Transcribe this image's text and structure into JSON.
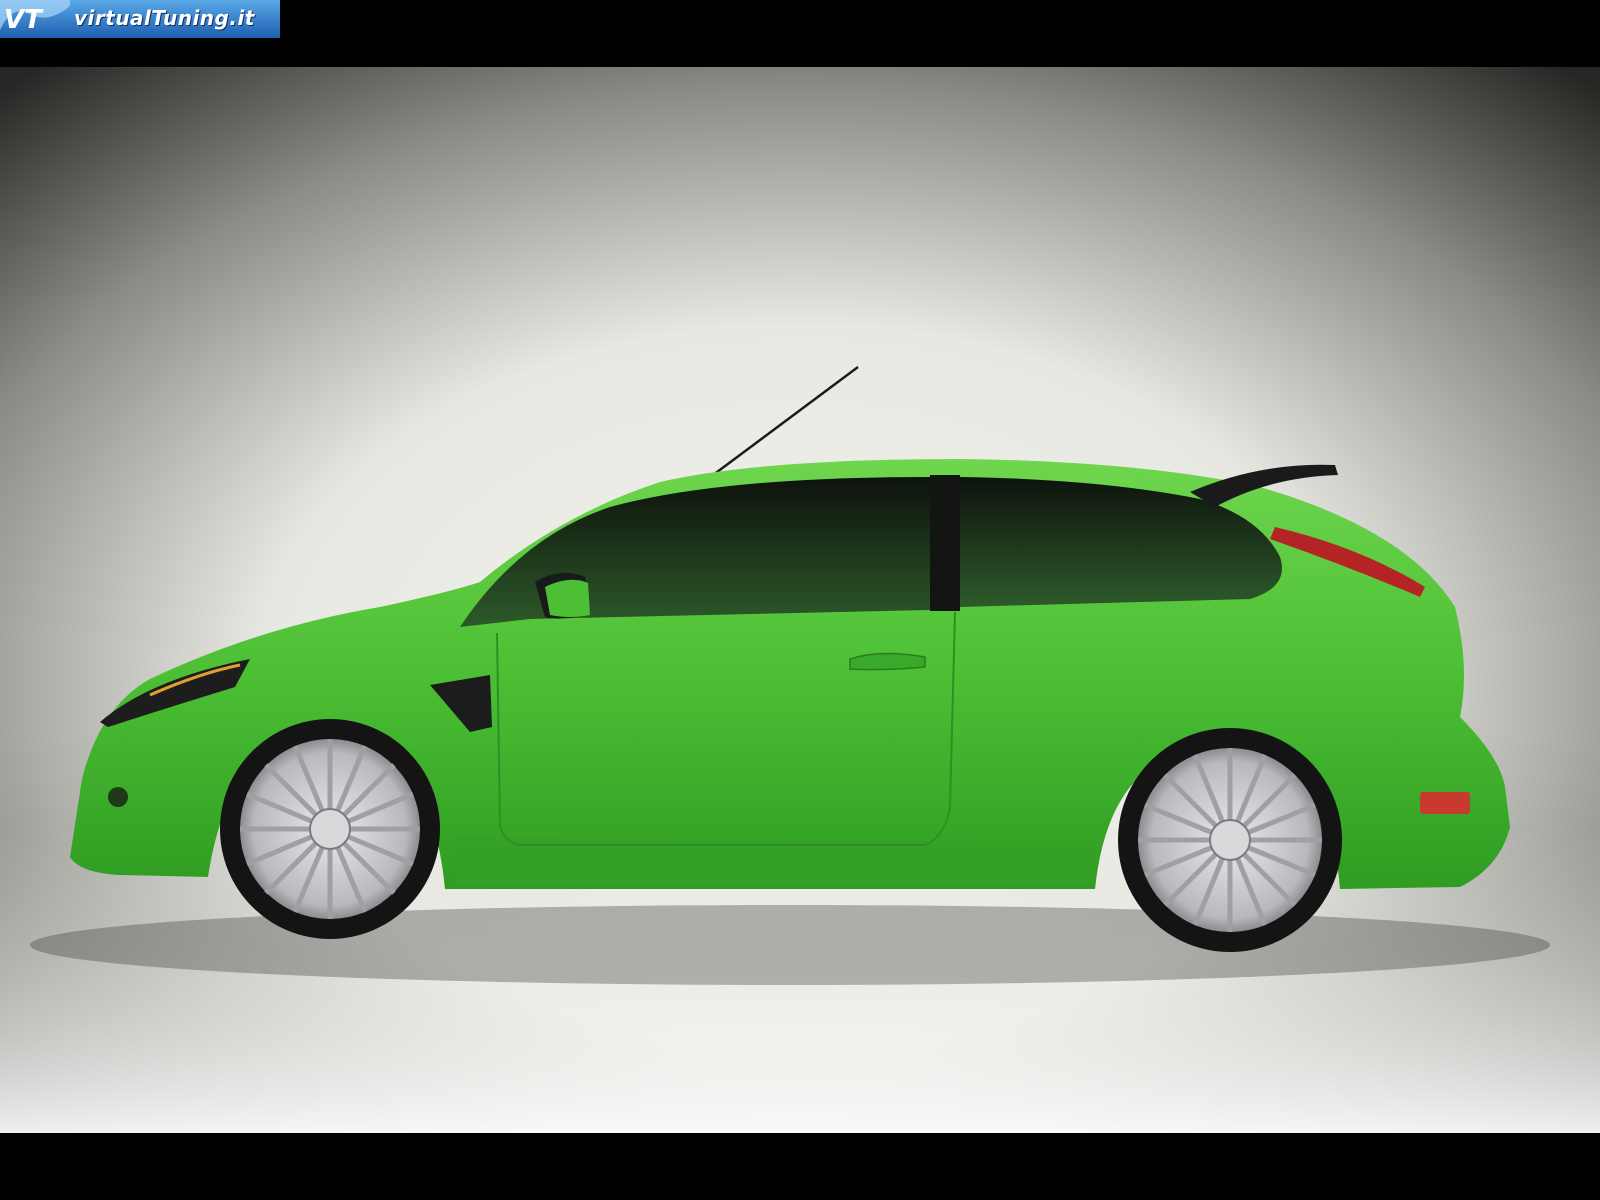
{
  "watermark": {
    "text": "virtualTuning.it",
    "icon": "vt-logo-icon"
  },
  "photo": {
    "subject": "car",
    "colors": {
      "body": "#4ec23a",
      "backdrop_light": "#f2f2ee",
      "backdrop_dark": "#2a2b28",
      "wheel": "#c9cacc",
      "tyre": "#151515"
    }
  }
}
